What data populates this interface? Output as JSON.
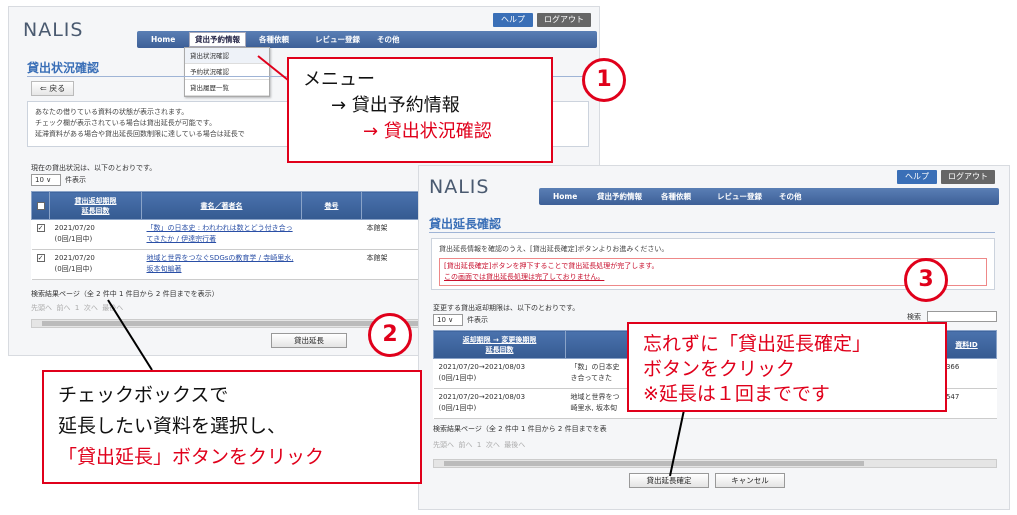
{
  "screen_a": {
    "logo": "NALIS",
    "help_label": "ヘルプ",
    "logout_label": "ログアウト",
    "nav": [
      "Home",
      "貸出予約情報",
      "各種依頼",
      "レビュー登録",
      "その他"
    ],
    "dropdown": [
      "貸出状況確認",
      "予約状況確認",
      "貸出履歴一覧"
    ],
    "title": "貸出状況確認",
    "back_label": "戻る",
    "notice": [
      "あなたの借りている資料の状態が表示されます。",
      "チェック欄が表示されている場合は貸出延長が可能です。",
      "延滞資料がある場合や貸出延長回数制限に達している場合は延長で"
    ],
    "status_text": "現在の貸出状況は、以下のとおりです。",
    "per_page_value": "10",
    "per_page_label": "件表示",
    "columns": [
      "貸出返却期限\n延長回数",
      "書名／著者名",
      "巻号"
    ],
    "rows": [
      {
        "date": "2021/07/20",
        "count": "(0回/1回中)",
        "title": "「数」の日本史 : われわれは数とどう付き合ってきたか / 伊達宗行著",
        "location": "本館架"
      },
      {
        "date": "2021/07/20",
        "count": "(0回/1回中)",
        "title": "地域と世界をつなぐSDGsの教育学 / 寺崎里水, 坂本旬編著",
        "location": "本館架"
      }
    ],
    "result_text": "検索結果ページ（全 2 件中 1 件目から 2 件目までを表示）",
    "pager": [
      "先頭へ",
      "前へ",
      "1",
      "次へ",
      "最後へ"
    ],
    "action_label": "貸出延長"
  },
  "screen_b": {
    "logo": "NALIS",
    "help_label": "ヘルプ",
    "logout_label": "ログアウト",
    "nav": [
      "Home",
      "貸出予約情報",
      "各種依頼",
      "レビュー登録",
      "その他"
    ],
    "title": "貸出延長確認",
    "notice_line": "貸出延長情報を確認のうえ、[貸出延長確定]ボタンよりお進みください。",
    "warn_1": "[貸出延長確定]ボタンを押下することで貸出延長処理が完了します。",
    "warn_2": "この画面では貸出延長処理は完了しておりません。",
    "status_text": "変更する貸出返却期限は、以下のとおりです。",
    "per_page_value": "10",
    "per_page_label": "件表示",
    "search_label": "検索",
    "columns": [
      "返却期限 → 変更後期限\n延長回数",
      "",
      "資料ID"
    ],
    "rows": [
      {
        "dates": "2021/07/20→2021/08/03",
        "count": "(0回/1回中)",
        "title": "「数」の日本史\nき合ってきた",
        "id": "3366"
      },
      {
        "dates": "2021/07/20→2021/08/03",
        "count": "(0回/1回中)",
        "title": "地域と世界をつ\n崎里水, 坂本旬",
        "id": "4547"
      }
    ],
    "result_text": "検索結果ページ（全 2 件中 1 件目から 2 件目までを表",
    "pager": [
      "先頭へ",
      "前へ",
      "1",
      "次へ",
      "最後へ"
    ],
    "confirm_label": "貸出延長確定",
    "cancel_label": "キャンセル"
  },
  "callouts": {
    "c1": {
      "number": "1",
      "line1": "メニュー",
      "line2": "→ 貸出予約情報",
      "line3": "→ 貸出状況確認"
    },
    "c2": {
      "number": "2",
      "line1": "チェックボックスで",
      "line2": "延長したい資料を選択し、",
      "line3a": "「貸出延長」",
      "line3b": "ボタンをクリック"
    },
    "c3": {
      "number": "3",
      "line1a": "忘れずに",
      "line1b": "「貸出延長確定」",
      "line2": "ボタンをクリック",
      "line3": "※延長は１回までです"
    }
  },
  "colors": {
    "accent_red": "#e0001b",
    "nav_blue": "#3d5f97"
  }
}
